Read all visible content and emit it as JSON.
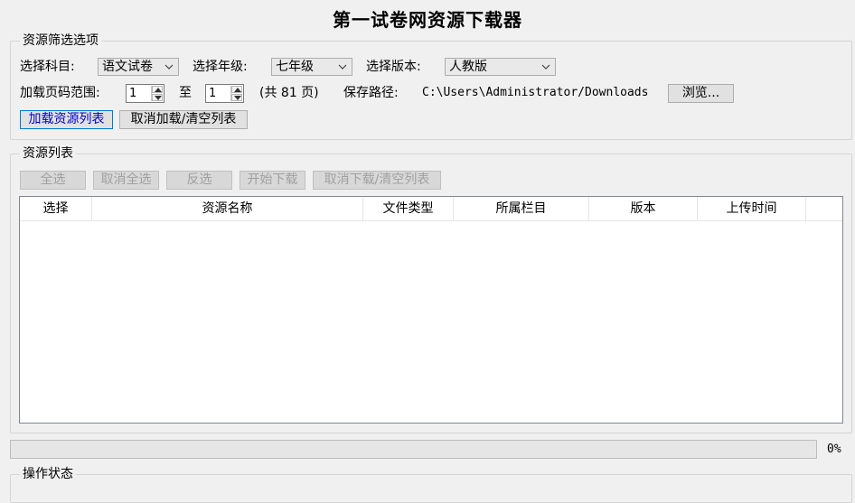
{
  "window": {
    "title": "第一试卷网资源下载器"
  },
  "filter": {
    "legend": "资源筛选选项",
    "subject_label": "选择科目:",
    "subject_value": "语文试卷",
    "grade_label": "选择年级:",
    "grade_value": "七年级",
    "edition_label": "选择版本:",
    "edition_value": "人教版",
    "page_range_label": "加载页码范围:",
    "page_from": "1",
    "to_label": "至",
    "page_to": "1",
    "total_pages": "(共 81 页)",
    "save_path_label": "保存路径:",
    "save_path": "C:\\Users\\Administrator/Downloads",
    "browse_label": "浏览...",
    "load_button": "加载资源列表",
    "cancel_load_button": "取消加载/清空列表"
  },
  "resources": {
    "legend": "资源列表",
    "buttons": {
      "select_all": "全选",
      "deselect_all": "取消全选",
      "invert": "反选",
      "start_download": "开始下载",
      "cancel_download": "取消下载/清空列表"
    },
    "columns": [
      "选择",
      "资源名称",
      "文件类型",
      "所属栏目",
      "版本",
      "上传时间"
    ],
    "rows": []
  },
  "progress": {
    "value": 0,
    "label": "0%"
  },
  "status": {
    "legend": "操作状态"
  }
}
